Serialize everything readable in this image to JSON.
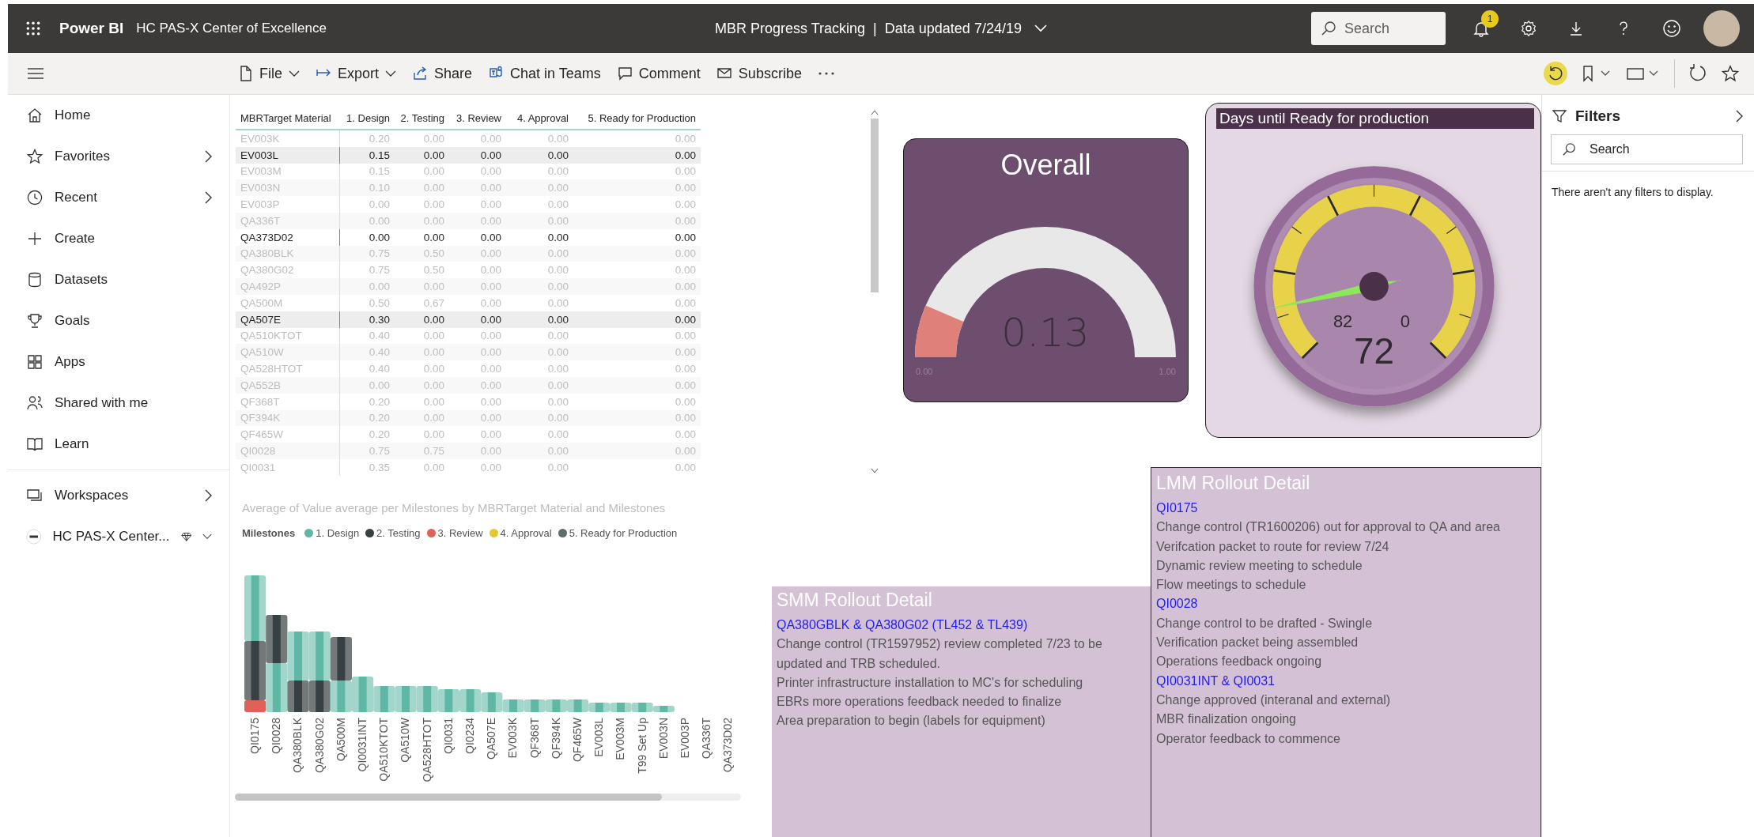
{
  "top_bar": {
    "app_name": "Power BI",
    "workspace": "HC PAS-X Center of Excellence",
    "report_title": "MBR Progress Tracking",
    "separator": "|",
    "data_updated": "Data updated 7/24/19",
    "search": {
      "placeholder": "Search"
    },
    "notification_count": "1"
  },
  "nav": {
    "items": [
      {
        "label": "Home",
        "has_submenu": false
      },
      {
        "label": "Favorites",
        "has_submenu": true
      },
      {
        "label": "Recent",
        "has_submenu": true
      },
      {
        "label": "Create",
        "has_submenu": false
      },
      {
        "label": "Datasets",
        "has_submenu": false
      },
      {
        "label": "Goals",
        "has_submenu": false
      },
      {
        "label": "Apps",
        "has_submenu": false
      },
      {
        "label": "Shared with me",
        "has_submenu": false
      },
      {
        "label": "Learn",
        "has_submenu": false
      }
    ],
    "workspaces": {
      "label": "Workspaces",
      "has_submenu": true
    },
    "current_workspace": {
      "label": "HC PAS-X Center...",
      "expanded": false
    }
  },
  "toolbar": {
    "items": [
      {
        "label": "File",
        "dropdown": true
      },
      {
        "label": "Export",
        "dropdown": true
      },
      {
        "label": "Share",
        "dropdown": false
      },
      {
        "label": "Chat in Teams",
        "dropdown": false
      },
      {
        "label": "Comment",
        "dropdown": false
      },
      {
        "label": "Subscribe",
        "dropdown": false
      }
    ]
  },
  "table": {
    "columns": [
      "MBRTarget Material",
      "1. Design",
      "2. Testing",
      "3. Review",
      "4. Approval",
      "5. Ready for Production"
    ],
    "rows": [
      {
        "material": "EV003K",
        "values": [
          "0.20",
          "0.00",
          "0.00",
          "0.00",
          "0.00"
        ],
        "selected": false
      },
      {
        "material": "EV003L",
        "values": [
          "0.15",
          "0.00",
          "0.00",
          "0.00",
          "0.00"
        ],
        "selected": true
      },
      {
        "material": "EV003M",
        "values": [
          "0.15",
          "0.00",
          "0.00",
          "0.00",
          "0.00"
        ],
        "selected": false
      },
      {
        "material": "EV003N",
        "values": [
          "0.10",
          "0.00",
          "0.00",
          "0.00",
          "0.00"
        ],
        "selected": false
      },
      {
        "material": "EV003P",
        "values": [
          "0.00",
          "0.00",
          "0.00",
          "0.00",
          "0.00"
        ],
        "selected": false
      },
      {
        "material": "QA336T",
        "values": [
          "0.00",
          "0.00",
          "0.00",
          "0.00",
          "0.00"
        ],
        "selected": false
      },
      {
        "material": "QA373D02",
        "values": [
          "0.00",
          "0.00",
          "0.00",
          "0.00",
          "0.00"
        ],
        "selected": true
      },
      {
        "material": "QA380BLK",
        "values": [
          "0.75",
          "0.50",
          "0.00",
          "0.00",
          "0.00"
        ],
        "selected": false
      },
      {
        "material": "QA380G02",
        "values": [
          "0.75",
          "0.50",
          "0.00",
          "0.00",
          "0.00"
        ],
        "selected": false
      },
      {
        "material": "QA492P",
        "values": [
          "0.00",
          "0.00",
          "0.00",
          "0.00",
          "0.00"
        ],
        "selected": false
      },
      {
        "material": "QA500M",
        "values": [
          "0.50",
          "0.67",
          "0.00",
          "0.00",
          "0.00"
        ],
        "selected": false
      },
      {
        "material": "QA507E",
        "values": [
          "0.30",
          "0.00",
          "0.00",
          "0.00",
          "0.00"
        ],
        "selected": true
      },
      {
        "material": "QA510KTOT",
        "values": [
          "0.40",
          "0.00",
          "0.00",
          "0.00",
          "0.00"
        ],
        "selected": false
      },
      {
        "material": "QA510W",
        "values": [
          "0.40",
          "0.00",
          "0.00",
          "0.00",
          "0.00"
        ],
        "selected": false
      },
      {
        "material": "QA528HTOT",
        "values": [
          "0.40",
          "0.00",
          "0.00",
          "0.00",
          "0.00"
        ],
        "selected": false
      },
      {
        "material": "QA552B",
        "values": [
          "0.00",
          "0.00",
          "0.00",
          "0.00",
          "0.00"
        ],
        "selected": false
      },
      {
        "material": "QF368T",
        "values": [
          "0.20",
          "0.00",
          "0.00",
          "0.00",
          "0.00"
        ],
        "selected": false
      },
      {
        "material": "QF394K",
        "values": [
          "0.20",
          "0.00",
          "0.00",
          "0.00",
          "0.00"
        ],
        "selected": false
      },
      {
        "material": "QF465W",
        "values": [
          "0.20",
          "0.00",
          "0.00",
          "0.00",
          "0.00"
        ],
        "selected": false
      },
      {
        "material": "QI0028",
        "values": [
          "0.75",
          "0.75",
          "0.00",
          "0.00",
          "0.00"
        ],
        "selected": false
      },
      {
        "material": "QI0031",
        "values": [
          "0.35",
          "0.00",
          "0.00",
          "0.00",
          "0.00"
        ],
        "selected": false
      }
    ]
  },
  "ribbon_chart": {
    "title": "Average of Value average per Milestones by MBRTarget Material and Milestones",
    "legend_title": "Milestones",
    "legend": [
      {
        "label": "1. Design",
        "color": "#5fb8a5"
      },
      {
        "label": "2. Testing",
        "color": "#374043"
      },
      {
        "label": "3. Review",
        "color": "#e0605a"
      },
      {
        "label": "4. Approval",
        "color": "#e5c82a"
      },
      {
        "label": "5. Ready for Production",
        "color": "#5f6b6d"
      }
    ],
    "x_labels": [
      "QI0175",
      "QI0028",
      "QA380BLK",
      "QA380G02",
      "QA500M",
      "QI0031INT",
      "QA510KTOT",
      "QA510W",
      "QA528HTOT",
      "QI0031",
      "QI0234",
      "QA507E",
      "EV003K",
      "QF368T",
      "QF394K",
      "QF465W",
      "EV003L",
      "EV003M",
      "T99 Set Up",
      "EV003N",
      "EV003P",
      "QA336T",
      "QA373D02"
    ]
  },
  "overall_gauge": {
    "title": "Overall",
    "value": "0.13",
    "level": 0.13,
    "min": "0.00",
    "max": "1.00"
  },
  "days_gauge": {
    "title": "Days until Ready for production",
    "value": "72",
    "start_label": "82",
    "end_label": "0"
  },
  "smm_detail": {
    "title": "SMM Rollout Detail",
    "lines": [
      {
        "kind": "link",
        "text": "QA380GBLK & QA380G02 (TL452 & TL439)"
      },
      {
        "kind": "text",
        "text": "Change control (TR1597952) review completed 7/23 to be updated and TRB scheduled."
      },
      {
        "kind": "text",
        "text": "Printer infrastructure installation to MC's for scheduling"
      },
      {
        "kind": "text",
        "text": "EBRs more operations feedback needed to finalize"
      },
      {
        "kind": "text",
        "text": "Area preparation to begin (labels for equipment)"
      }
    ]
  },
  "lmm_detail": {
    "title": "LMM Rollout Detail",
    "lines": [
      {
        "kind": "link",
        "text": "QI0175"
      },
      {
        "kind": "text",
        "text": "Change control (TR1600206) out for approval to QA and area"
      },
      {
        "kind": "text",
        "text": "Verifcation packet to route for review 7/24"
      },
      {
        "kind": "text",
        "text": "Dynamic review meeting to schedule"
      },
      {
        "kind": "text",
        "text": "Flow meetings to schedule"
      },
      {
        "kind": "link",
        "text": "QI0028"
      },
      {
        "kind": "text",
        "text": "Change control to be drafted - Swingle"
      },
      {
        "kind": "text",
        "text": "Verification packet being assembled"
      },
      {
        "kind": "text",
        "text": "Operations feedback ongoing"
      },
      {
        "kind": "link",
        "text": "QI0031INT & QI0031"
      },
      {
        "kind": "text",
        "text": "Change approved (interanal and external)"
      },
      {
        "kind": "text",
        "text": "MBR finalization ongoing"
      },
      {
        "kind": "text",
        "text": "Operator feedback to commence"
      }
    ]
  },
  "filters": {
    "title": "Filters",
    "search": {
      "placeholder": "Search"
    },
    "empty_message": "There aren't any filters to display."
  }
}
